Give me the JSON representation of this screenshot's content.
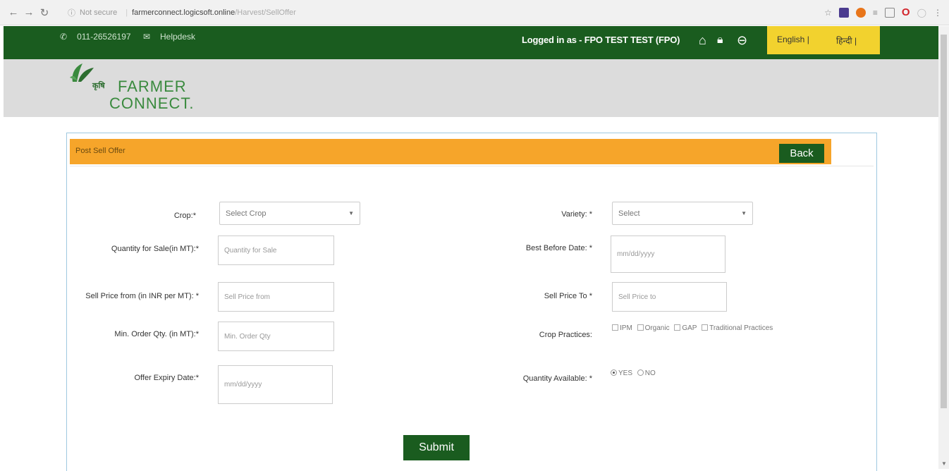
{
  "browser": {
    "security": "Not secure",
    "host": "farmerconnect.logicsoft.online",
    "path": "/Harvest/SellOffer"
  },
  "topbar": {
    "phone": "011-26526197",
    "helpdesk": "Helpdesk",
    "logged_in": "Logged in as - FPO TEST TEST (FPO)",
    "lang_english": "English |",
    "lang_hindi": "हिन्दी |"
  },
  "logo": {
    "line1": "FARMER",
    "line2": "CONNECT."
  },
  "form": {
    "title": "Post Sell Offer",
    "back_label": "Back",
    "crop_label": "Crop:*",
    "crop_value": "Select Crop",
    "variety_label": "Variety: *",
    "variety_value": "Select",
    "qty_label": "Quantity for Sale(in MT):*",
    "qty_placeholder": "Quantity for Sale",
    "best_before_label": "Best Before Date: *",
    "best_before_placeholder": "mm/dd/yyyy",
    "price_from_label": "Sell Price from (in INR per MT): *",
    "price_from_placeholder": "Sell Price from",
    "price_to_label": "Sell Price To *",
    "price_to_placeholder": "Sell Price to",
    "min_order_label": "Min. Order Qty. (in MT):*",
    "min_order_placeholder": "Min. Order Qty",
    "practices_label": "Crop Practices:",
    "practice_ipm": "IPM",
    "practice_organic": "Organic",
    "practice_gap": "GAP",
    "practice_traditional": "Traditional Practices",
    "expiry_label": "Offer Expiry Date:*",
    "expiry_placeholder": "mm/dd/yyyy",
    "qty_available_label": "Quantity Available: *",
    "yes": "YES",
    "no": "NO",
    "submit_label": "Submit"
  },
  "colors": {
    "brand_green": "#1a5c1f",
    "header_orange": "#f6a52a",
    "lang_yellow": "#f2d22e"
  }
}
